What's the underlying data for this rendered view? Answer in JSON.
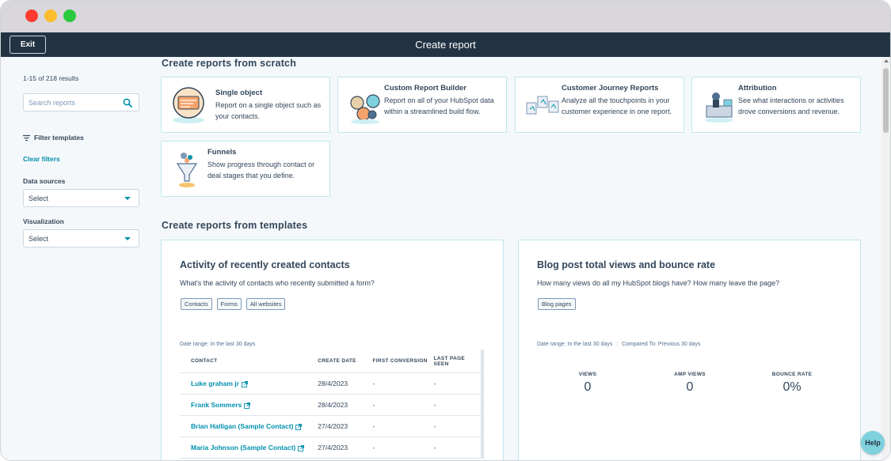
{
  "topbar": {
    "exit_label": "Exit",
    "title": "Create report"
  },
  "sidebar": {
    "results_text": "1-15 of 218 results",
    "search_placeholder": "Search reports",
    "filter_label": "Filter templates",
    "clear_filters": "Clear filters",
    "data_sources_label": "Data sources",
    "data_sources_value": "Select",
    "visualization_label": "Visualization",
    "visualization_value": "Select"
  },
  "scratch": {
    "heading": "Create reports from scratch",
    "cards": [
      {
        "title": "Single object",
        "desc": "Report on a single object such as your contacts.",
        "icon": "single-object-icon"
      },
      {
        "title": "Custom Report Builder",
        "desc": "Report on all of your HubSpot data within a streamlined build flow.",
        "icon": "custom-report-builder-icon"
      },
      {
        "title": "Customer Journey Reports",
        "desc": "Analyze all the touchpoints in your customer experience in one report.",
        "icon": "customer-journey-icon"
      },
      {
        "title": "Attribution",
        "desc": "See what interactions or activities drove conversions and revenue.",
        "icon": "attribution-icon"
      },
      {
        "title": "Funnels",
        "desc": "Show progress through contact or deal stages that you define.",
        "icon": "funnels-icon"
      }
    ]
  },
  "templates": {
    "heading": "Create reports from templates",
    "activity": {
      "title": "Activity of recently created contacts",
      "question": "What's the activity of contacts who recently submitted a form?",
      "tags": [
        "Contacts",
        "Forms",
        "All websites"
      ],
      "date_range": "Date range: In the last 30 days",
      "columns": [
        "CONTACT",
        "CREATE DATE",
        "FIRST CONVERSION",
        "LAST PAGE SEEN"
      ],
      "rows": [
        {
          "contact": "Luke graham jr",
          "create_date": "28/4/2023",
          "first_conversion": "-",
          "last_page_seen": "-"
        },
        {
          "contact": "Frank Sommers",
          "create_date": "28/4/2023",
          "first_conversion": "-",
          "last_page_seen": "-"
        },
        {
          "contact": "Brian Halligan (Sample Contact)",
          "create_date": "27/4/2023",
          "first_conversion": "-",
          "last_page_seen": "-"
        },
        {
          "contact": "Maria Johnson (Sample Contact)",
          "create_date": "27/4/2023",
          "first_conversion": "-",
          "last_page_seen": "-"
        }
      ]
    },
    "blog": {
      "title": "Blog post total views and bounce rate",
      "question": "How many views do all my HubSpot blogs have? How many leave the page?",
      "tags": [
        "Blog pages"
      ],
      "date_range": "Date range: In the last 30 days",
      "compared_to": "Compared To: Previous 30 days",
      "kpis": [
        {
          "label": "VIEWS",
          "value": "0"
        },
        {
          "label": "AMP VIEWS",
          "value": "0"
        },
        {
          "label": "BOUNCE RATE",
          "value": "0%"
        }
      ]
    }
  },
  "help_label": "Help",
  "colors": {
    "topbar": "#213343",
    "accent": "#0091ae",
    "card_border": "#bee6ec",
    "help": "#7fd1de"
  }
}
